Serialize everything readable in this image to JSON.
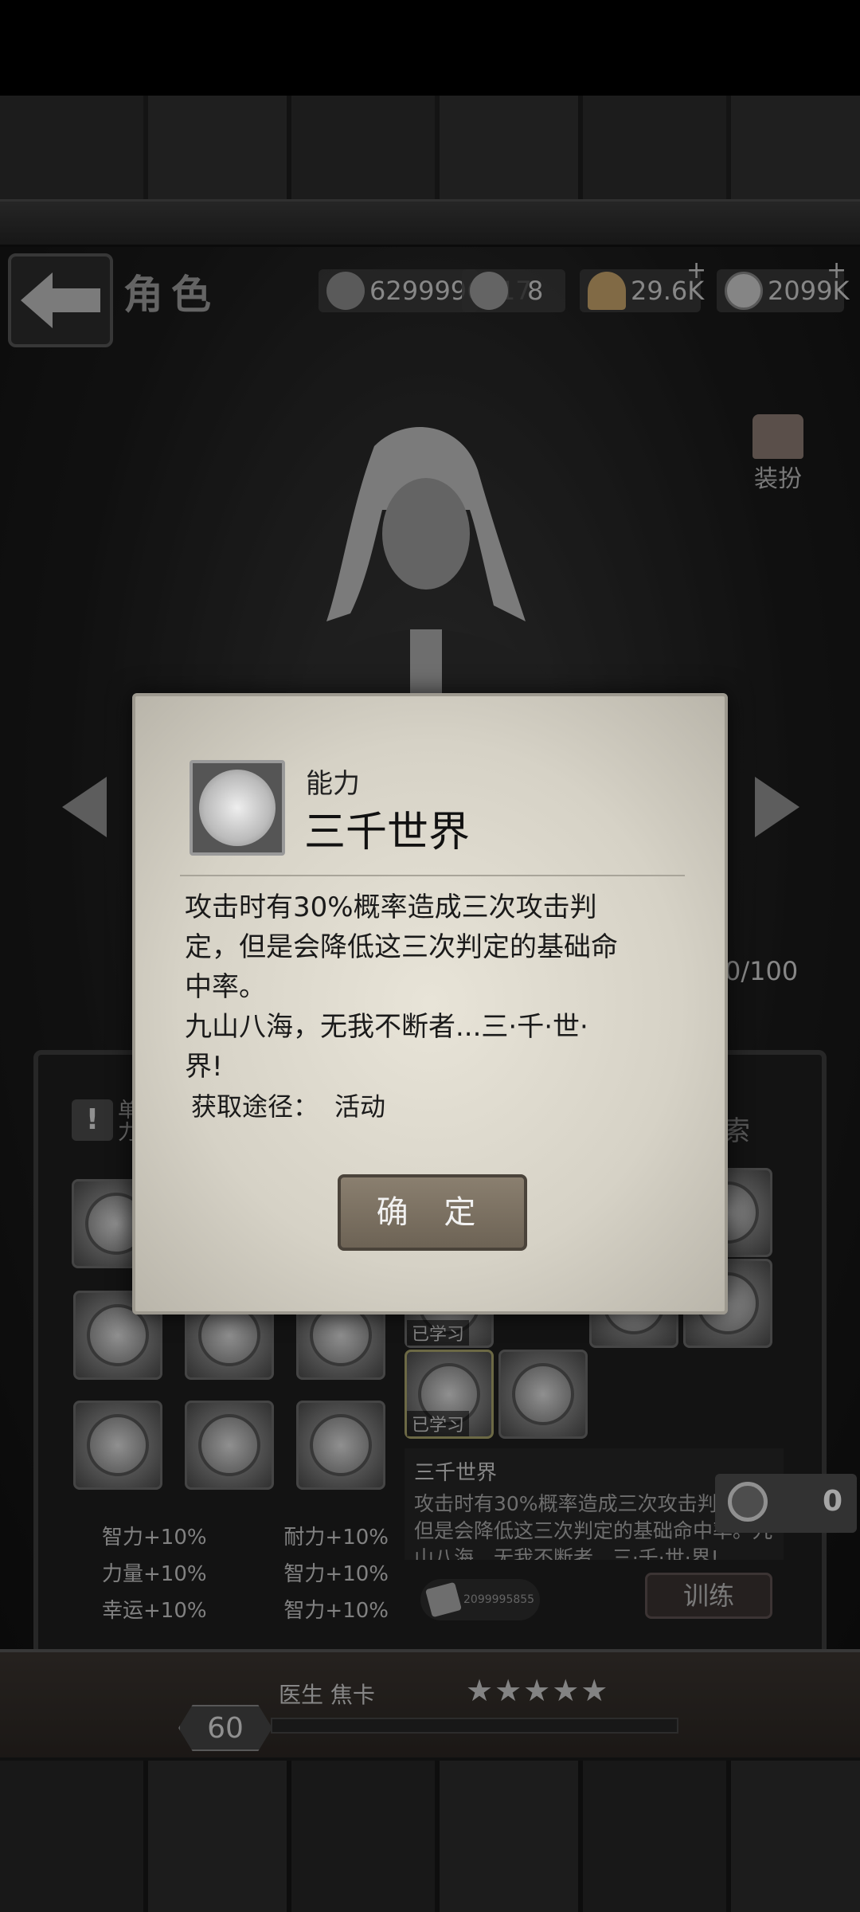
{
  "header": {
    "title": "角色",
    "resources": [
      {
        "icon": "puzzle-icon",
        "value": "6299996117"
      },
      {
        "icon": "puzzle-piece-icon",
        "value": "8"
      },
      {
        "icon": "shell-icon",
        "value": "29.6K"
      },
      {
        "icon": "coin-icon",
        "value": "2099K"
      }
    ],
    "plus": "+"
  },
  "dress_up": {
    "label": "装扮"
  },
  "progress_text": "0/100",
  "panel": {
    "warning": "!",
    "warning_text": "单力",
    "search_tab": "索",
    "learned_label": "已学习",
    "stats": [
      [
        "智力+10%",
        "耐力+10%"
      ],
      [
        "力量+10%",
        "智力+10%"
      ],
      [
        "幸运+10%",
        "智力+10%"
      ]
    ],
    "skill_name": "三千世界",
    "skill_desc": "攻击时有30%概率造成三次攻击判定，但是会降低这三次判定的基础命中率。九山八海，无我不断者...三·千·世·界!",
    "ticket_value": "2099995855",
    "train_label": "训练",
    "counter_value": "0"
  },
  "character": {
    "role": "医生",
    "name": "焦卡",
    "level": "60",
    "stars": "★★★★★",
    "star_count": 5
  },
  "dialog": {
    "category": "能力",
    "name": "三千世界",
    "description_lines": [
      "攻击时有30%概率造成三次攻击判",
      "定，但是会降低这三次判定的基础命",
      "中率。",
      "九山八海，无我不断者...三·千·世·",
      "界!"
    ],
    "source_label": "获取途径：",
    "source_value": "活动",
    "confirm_label": "确 定"
  }
}
